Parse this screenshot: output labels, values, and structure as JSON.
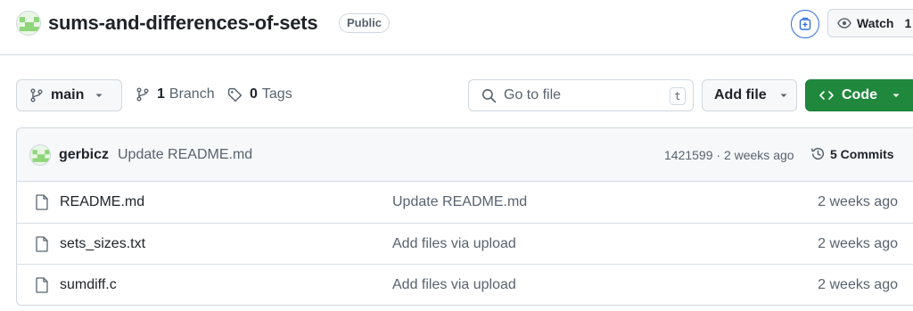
{
  "repo": {
    "name": "sums-and-differences-of-sets",
    "visibility": "Public"
  },
  "header": {
    "watch_label": "Watch",
    "watch_count": "1"
  },
  "toolbar": {
    "branch_name": "main",
    "branch_count": "1",
    "branch_label": "Branch",
    "tag_count": "0",
    "tag_label": "Tags",
    "search_placeholder": "Go to file",
    "search_shortcut": "t",
    "add_file_label": "Add file",
    "code_label": "Code"
  },
  "latest_commit": {
    "author": "gerbicz",
    "message": "Update README.md",
    "hash_and_time": "1421599 · 2 weeks ago",
    "commits_label": "5 Commits"
  },
  "files": [
    {
      "name": "README.md",
      "commit": "Update README.md",
      "age": "2 weeks ago"
    },
    {
      "name": "sets_sizes.txt",
      "commit": "Add files via upload",
      "age": "2 weeks ago"
    },
    {
      "name": "sumdiff.c",
      "commit": "Add files via upload",
      "age": "2 weeks ago"
    }
  ],
  "colors": {
    "code_button": "#1f883d",
    "avatar_green": "#8fd67a",
    "pin_blue": "#2f6fdb"
  }
}
